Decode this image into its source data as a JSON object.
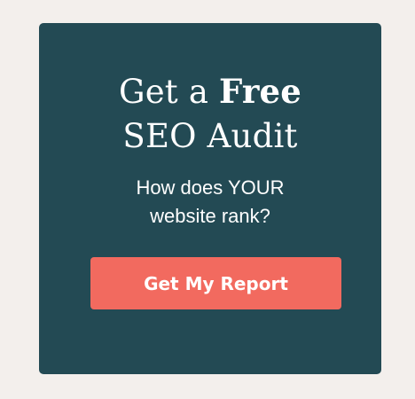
{
  "promo": {
    "headline_prefix": "Get a ",
    "headline_bold": "Free",
    "headline_line2": "SEO Audit",
    "subtext_line1": "How does YOUR",
    "subtext_line2": "website rank?",
    "cta_label": "Get My Report"
  },
  "colors": {
    "page_background": "#f3efec",
    "card_background": "#234a54",
    "cta_background": "#f26a5f",
    "text": "#ffffff"
  }
}
